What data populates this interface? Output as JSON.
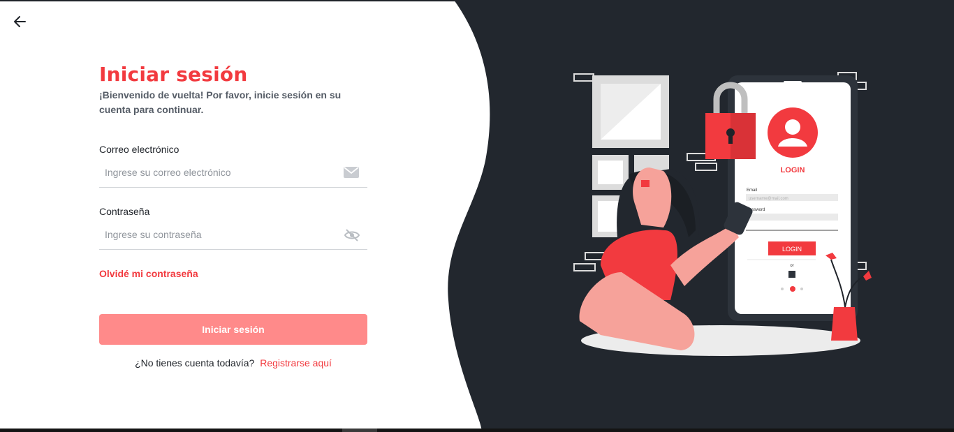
{
  "login": {
    "title": "Iniciar sesión",
    "subtitle": "¡Bienvenido de vuelta! Por favor, inicie sesión en su cuenta para continuar.",
    "email": {
      "label": "Correo electrónico",
      "placeholder": "Ingrese su correo electrónico",
      "value": "",
      "icon": "mail-icon"
    },
    "password": {
      "label": "Contraseña",
      "placeholder": "Ingrese su contraseña",
      "value": "",
      "icon": "eye-off-icon"
    },
    "forgot_link": "Olvidé mi contraseña",
    "submit_label": "Iniciar sesión",
    "register_prompt": "¿No tienes cuenta todavía?",
    "register_link": "Registrarse aquí"
  },
  "nav": {
    "back_icon": "arrow-left-icon"
  },
  "illustration": {
    "phone_heading": "LOGIN",
    "email_label": "Email",
    "email_placeholder": "username@mail.com",
    "password_label": "Password",
    "button_label": "LOGIN",
    "or_label": "or"
  },
  "colors": {
    "accent": "#f23a3f",
    "button_disabled": "#ff8a8a",
    "dark_panel": "#22272e",
    "text_muted": "#555c66"
  }
}
